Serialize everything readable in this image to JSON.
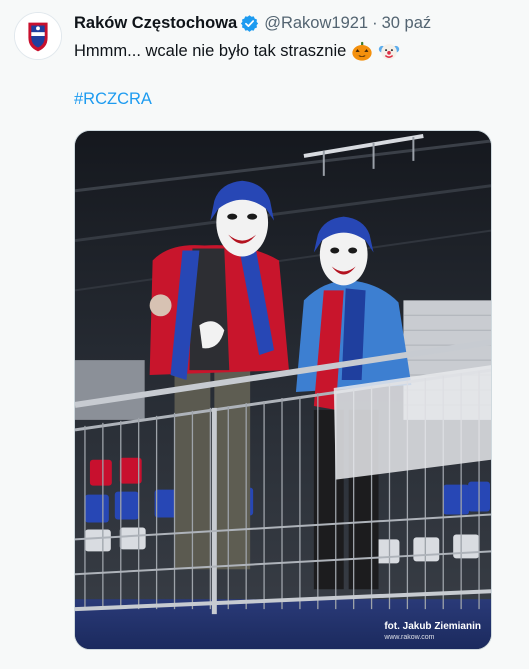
{
  "tweet": {
    "author_name": "Raków Częstochowa",
    "verified": true,
    "handle": "@Rakow1921",
    "separator": "·",
    "date": "30 paź",
    "text": "Hmmm... wcale nie było tak strasznie",
    "emojis": [
      "jack-o-lantern-icon",
      "clown-face-icon"
    ],
    "hashtag": "#RCZCRA"
  },
  "media": {
    "description_icon": "photo",
    "credit_line1": "fot. Jakub Ziemianin",
    "credit_line2": "www.rakow.com"
  },
  "colors": {
    "background": "#f7f9f9",
    "link": "#1d9bf0",
    "verified": "#1d9bf0",
    "secondary_text": "#536471",
    "club_red": "#c8102e",
    "club_blue": "#1f3f9e"
  }
}
